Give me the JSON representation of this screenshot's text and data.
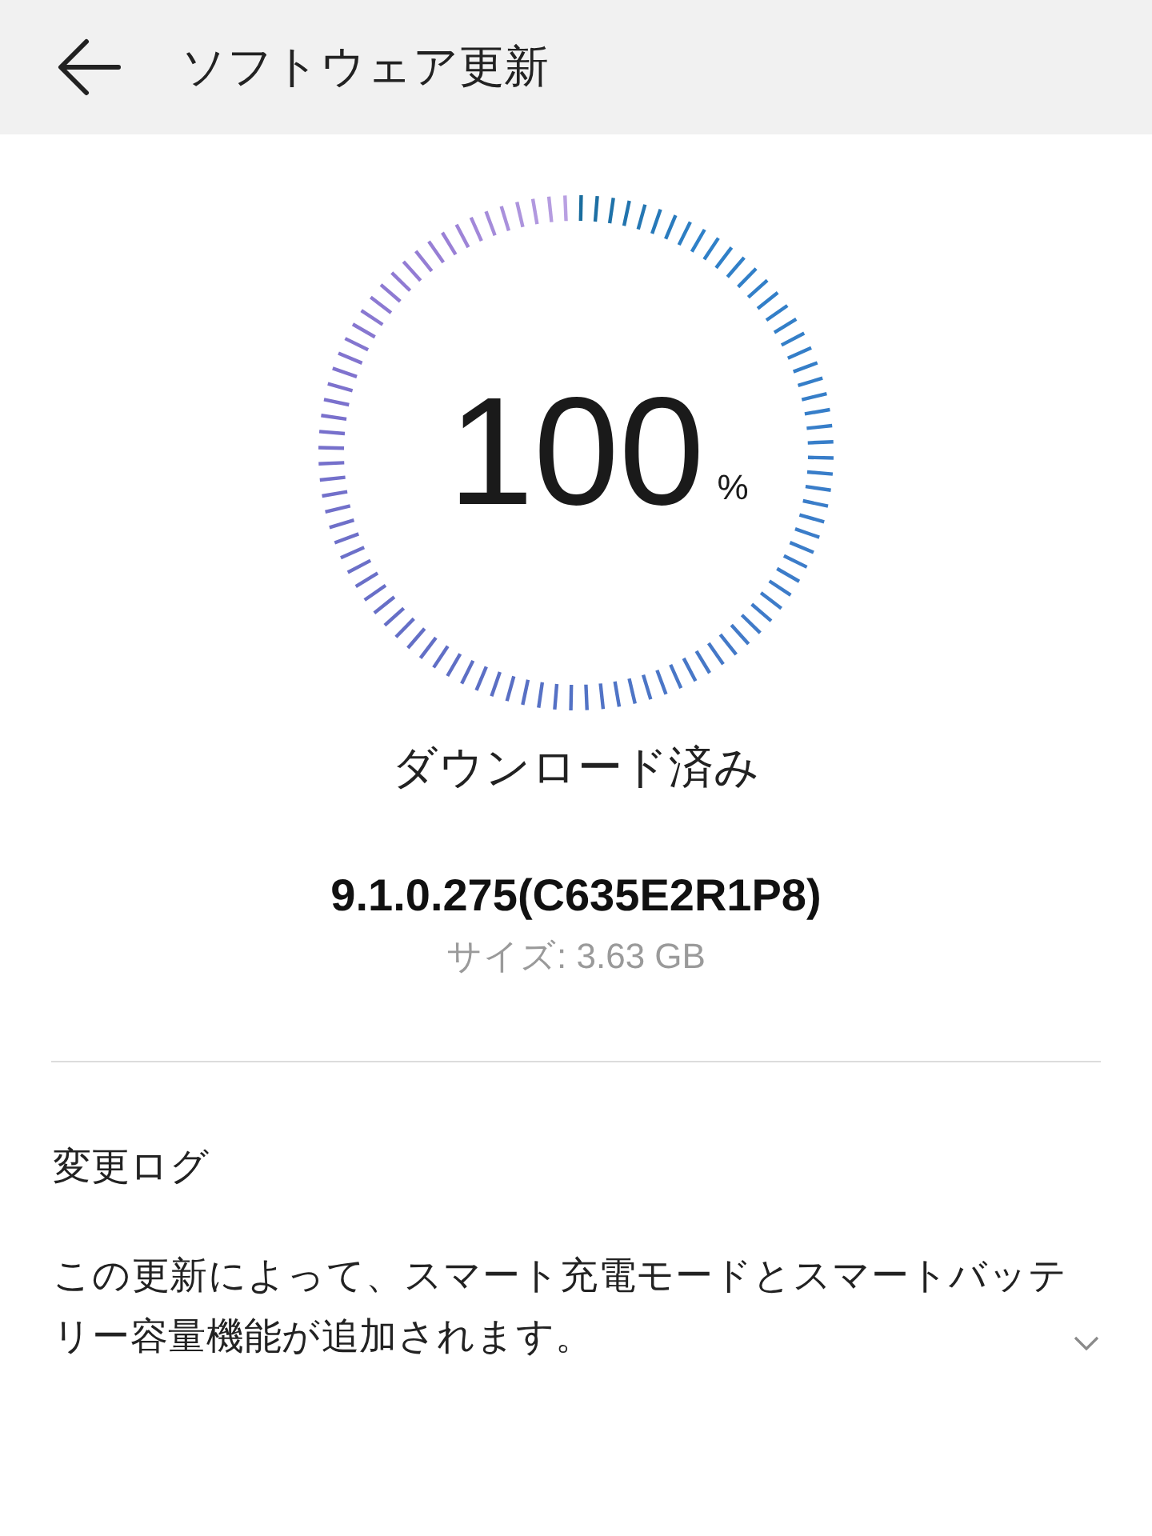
{
  "header": {
    "title": "ソフトウェア更新"
  },
  "progress": {
    "level": 1,
    "value": "100",
    "unit": "%",
    "status": "ダウンロード済み"
  },
  "update": {
    "version": "9.1.0.275(C635E2R1P8)",
    "size": "サイズ: 3.63 GB"
  },
  "changelog": {
    "heading": "変更ログ",
    "text": "この更新によって、スマート充電モードとスマートバッテリー容量機能が追加されます。",
    "expanded": false
  }
}
